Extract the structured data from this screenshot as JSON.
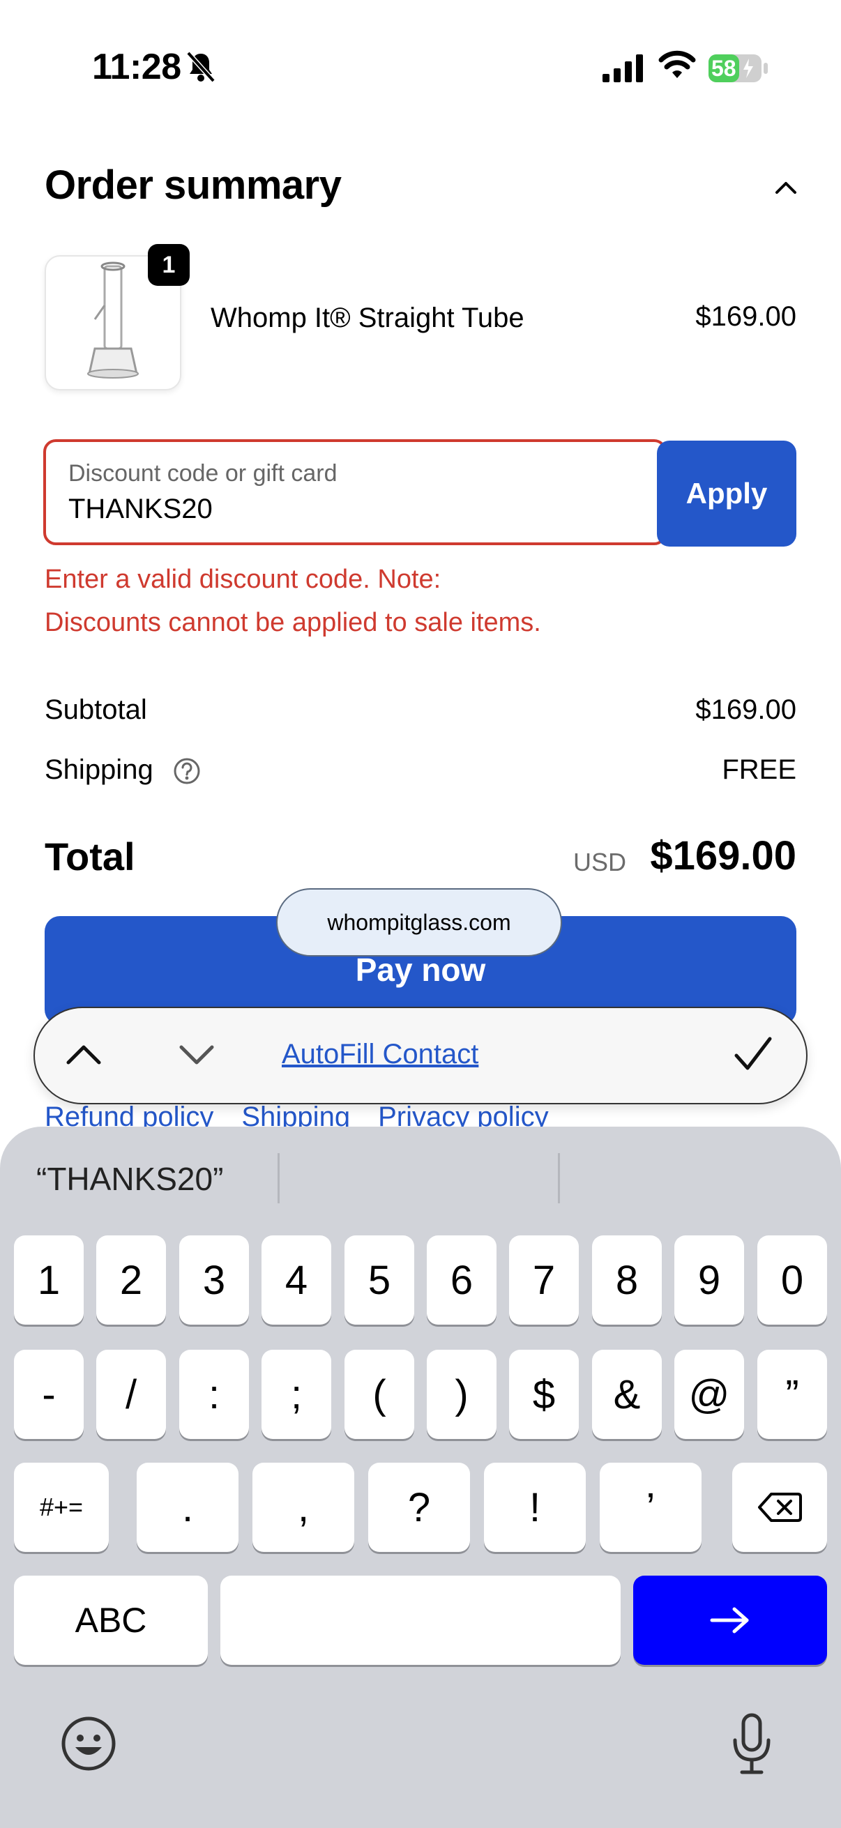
{
  "status_bar": {
    "time": "11:28",
    "battery": "58"
  },
  "order_summary": {
    "title": "Order summary",
    "item": {
      "quantity": "1",
      "name": "Whomp It® Straight Tube",
      "price": "$169.00"
    },
    "discount": {
      "label": "Discount code or gift card",
      "value": "THANKS20",
      "apply_label": "Apply",
      "error_line1": "Enter a valid discount code. Note:",
      "error_line2": "Discounts cannot be applied to sale items."
    },
    "subtotal": {
      "label": "Subtotal",
      "value": "$169.00"
    },
    "shipping": {
      "label": "Shipping",
      "value": "FREE"
    },
    "total": {
      "label": "Total",
      "currency": "USD",
      "value": "$169.00"
    },
    "pay_now": "Pay now",
    "links": [
      "Refund policy",
      "Shipping",
      "Privacy policy"
    ]
  },
  "browser": {
    "domain": "whompitglass.com"
  },
  "autofill_bar": {
    "label": "AutoFill Contact"
  },
  "keyboard": {
    "suggestion": "“THANKS20”",
    "row1": [
      "1",
      "2",
      "3",
      "4",
      "5",
      "6",
      "7",
      "8",
      "9",
      "0"
    ],
    "row2": [
      "-",
      "/",
      ":",
      ";",
      "(",
      ")",
      "$",
      "&",
      "@",
      "”"
    ],
    "row3": [
      ".",
      ",",
      "?",
      "!",
      "’"
    ],
    "symbols_key": "#+=",
    "abc_key": "ABC"
  },
  "colors": {
    "accent": "#2457c9",
    "error": "#cf3a2f",
    "go_key": "#0000ff"
  }
}
